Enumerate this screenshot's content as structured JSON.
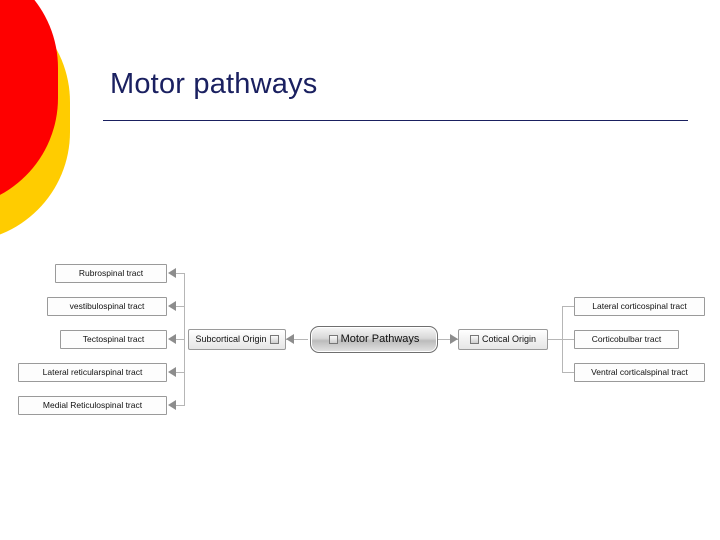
{
  "slide": {
    "title": "Motor pathways",
    "decorations": [
      {
        "name": "red-circle-shape",
        "color": "#fe0000"
      },
      {
        "name": "yellow-circle-shape",
        "color": "#ffcc00"
      }
    ]
  },
  "diagram": {
    "type": "hierarchy",
    "center_node": "Motor Pathways",
    "left_branch": {
      "origin": "Subcortical Origin",
      "tracts": [
        "Rubrospinal tract",
        "vestibulospinal tract",
        "Tectospinal tract",
        "Lateral reticularspinal tract",
        "Medial Reticulospinal tract"
      ]
    },
    "right_branch": {
      "origin": "Cotical Origin",
      "tracts": [
        "Lateral corticospinal tract",
        "Corticobulbar tract",
        "Ventral corticalspinal tract"
      ]
    }
  }
}
